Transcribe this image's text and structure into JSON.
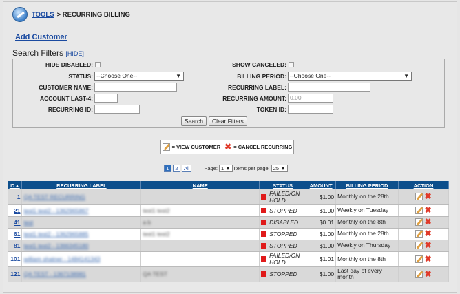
{
  "breadcrumb": {
    "tools": "TOOLS",
    "current": "> RECURRING BILLING"
  },
  "add_customer": "Add Customer",
  "search_filters": {
    "title": "Search Filters",
    "hide_link": "[HIDE]",
    "hide_disabled_label": "HIDE DISABLED:",
    "show_canceled_label": "SHOW CANCELED:",
    "status_label": "STATUS:",
    "status_value": "--Choose One--",
    "billing_period_label": "BILLING PERIOD:",
    "billing_period_value": "--Choose One--",
    "customer_name_label": "CUSTOMER NAME:",
    "recurring_label_label": "RECURRING LABEL:",
    "account_last4_label": "ACCOUNT LAST-4:",
    "recurring_amount_label": "RECURRING AMOUNT:",
    "recurring_amount_placeholder": "0.00",
    "recurring_id_label": "RECURRING ID:",
    "token_id_label": "TOKEN ID:",
    "search_button": "Search",
    "clear_button": "Clear Filters"
  },
  "legend": {
    "view": "= VIEW CUSTOMER",
    "cancel": "= CANCEL RECURRING"
  },
  "pager": {
    "pages": [
      "1",
      "2",
      "All"
    ],
    "page_label": "Page:",
    "page_value": "1",
    "items_label": "Items per page:",
    "items_value": "25"
  },
  "table": {
    "headers": [
      "ID▲",
      "RECURRING LABEL",
      "NAME",
      "STATUS",
      "AMOUNT",
      "BILLING PERIOD",
      "ACTION"
    ],
    "rows": [
      {
        "id": "1",
        "label": "QA TEST RECURRING",
        "name": "",
        "status": "FAILED/ON HOLD",
        "amount": "$1.00",
        "period": "Monthly on the 28th"
      },
      {
        "id": "21",
        "label": "test1 test2 - 1362965867",
        "name": "test1 test2",
        "status": "STOPPED",
        "amount": "$1.00",
        "period": "Weekly on Tuesday"
      },
      {
        "id": "41",
        "label": "test",
        "name": "a b",
        "status": "DISABLED",
        "amount": "$0.01",
        "period": "Monthly on the 8th"
      },
      {
        "id": "61",
        "label": "test1 test2 - 1362965885",
        "name": "test1 test2",
        "status": "STOPPED",
        "amount": "$1.00",
        "period": "Monthly on the 28th"
      },
      {
        "id": "81",
        "label": "test1 test2 - 1366345180",
        "name": "",
        "status": "STOPPED",
        "amount": "$1.00",
        "period": "Weekly on Thursday"
      },
      {
        "id": "101",
        "label": "william shatner - 1484141343",
        "name": "",
        "status": "FAILED/ON HOLD",
        "amount": "$1.01",
        "period": "Monthly on the 8th"
      },
      {
        "id": "121",
        "label": "QA TEST - 1367138981",
        "name": "QA TEST",
        "status": "STOPPED",
        "amount": "$1.00",
        "period": "Last day of every month"
      }
    ]
  },
  "colors": {
    "header_bg": "#0d4f8c",
    "status_square": "#e01a1a",
    "link": "#1a4aa0"
  }
}
